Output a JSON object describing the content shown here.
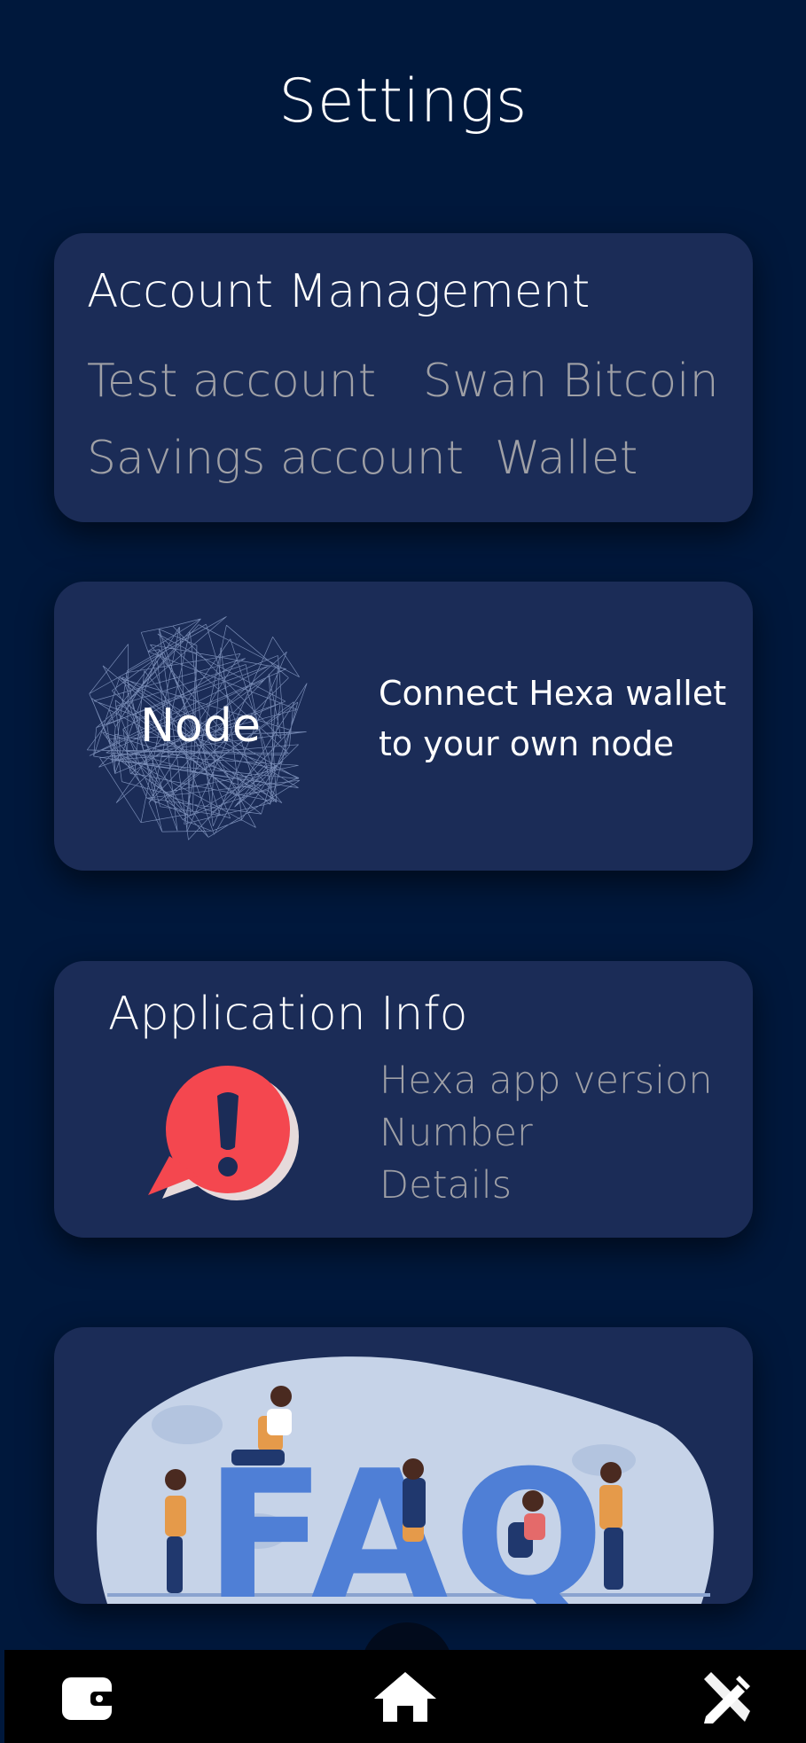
{
  "header": {
    "title": "Settings"
  },
  "account_management": {
    "heading": "Account Management",
    "accounts": [
      "Test account",
      "Swan Bitcoin",
      "Savings account",
      "Wallet"
    ]
  },
  "node": {
    "label": "Node",
    "description": "Connect Hexa wallet to your own node"
  },
  "application_info": {
    "heading": "Application Info",
    "lines": [
      "Hexa app version",
      "Number",
      "Details"
    ],
    "icon": "alert-speech-bubble-icon"
  },
  "faq": {
    "banner_text": "FAQ"
  },
  "bottom_nav": {
    "items": [
      "wallet-icon",
      "home-icon",
      "tools-icon"
    ]
  },
  "colors": {
    "background": "#00183c",
    "card": "#1b2c57",
    "muted_text": "#9fa0a6",
    "alert_red": "#f4474f",
    "faq_blue": "#4f7fd6"
  }
}
